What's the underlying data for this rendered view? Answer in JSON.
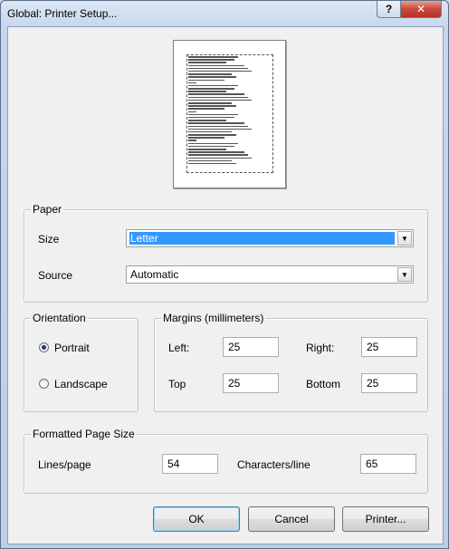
{
  "window": {
    "title": "Global: Printer Setup..."
  },
  "titlebar": {
    "help_label": "?",
    "close_label": "✕"
  },
  "paper": {
    "legend": "Paper",
    "size_label": "Size",
    "size_value": "Letter",
    "source_label": "Source",
    "source_value": "Automatic"
  },
  "orientation": {
    "legend": "Orientation",
    "portrait_label": "Portrait",
    "landscape_label": "Landscape",
    "selected": "Portrait"
  },
  "margins": {
    "legend": "Margins (millimeters)",
    "left_label": "Left:",
    "left_value": "25",
    "right_label": "Right:",
    "right_value": "25",
    "top_label": "Top",
    "top_value": "25",
    "bottom_label": "Bottom",
    "bottom_value": "25"
  },
  "page_size": {
    "legend": "Formatted Page Size",
    "lines_label": "Lines/page",
    "lines_value": "54",
    "chars_label": "Characters/line",
    "chars_value": "65"
  },
  "buttons": {
    "ok": "OK",
    "cancel": "Cancel",
    "printer": "Printer..."
  },
  "icons": {
    "help": "help-icon",
    "close": "close-icon",
    "dropdown": "chevron-down-icon"
  }
}
